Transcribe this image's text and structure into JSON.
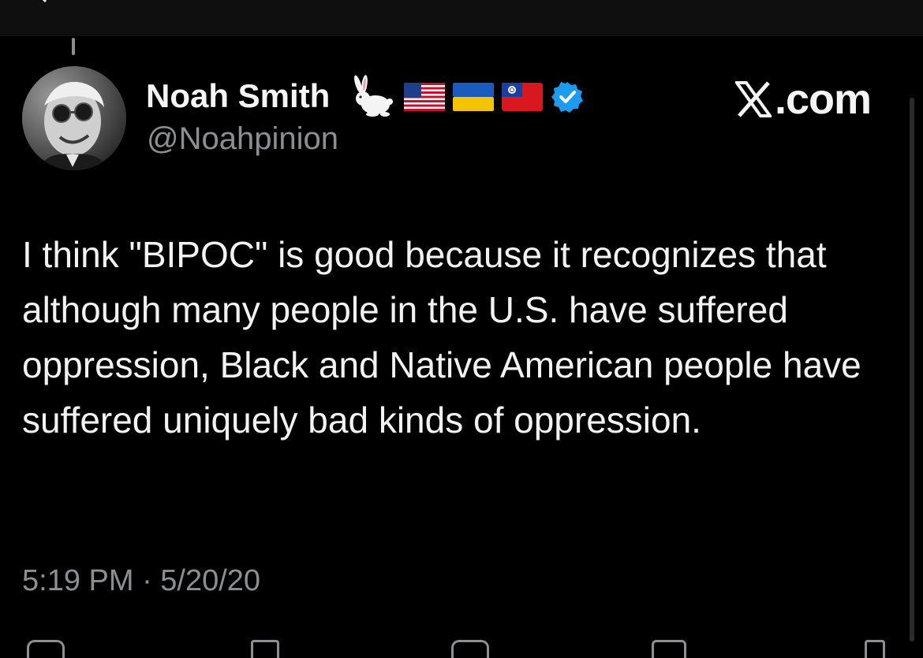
{
  "tweet": {
    "author": {
      "display_name": "Noah Smith",
      "handle": "@Noahpinion",
      "badges": [
        "rabbit-emoji",
        "us-flag",
        "ukraine-flag",
        "taiwan-flag",
        "verified-badge"
      ],
      "verified_color": "#1d9bf0"
    },
    "brand": {
      "text": ".com",
      "logo": "x-logo"
    },
    "body": "I think \"BIPOC\" is good because it recognizes that although many people in the U.S. have suffered oppression, Black and Native American people have suffered uniquely bad kinds of oppression.",
    "timestamp": "5:19 PM · 5/20/20"
  },
  "actions": [
    "reply-icon",
    "repost-icon",
    "like-icon",
    "bookmark-icon",
    "share-icon"
  ],
  "colors": {
    "background": "#000000",
    "text": "#e7e9ea",
    "secondary_text": "#8b8f94"
  }
}
